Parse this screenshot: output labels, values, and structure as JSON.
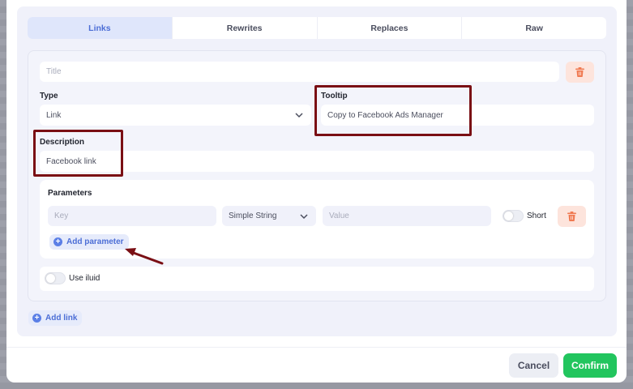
{
  "tabs": [
    {
      "label": "Links",
      "active": true
    },
    {
      "label": "Rewrites",
      "active": false
    },
    {
      "label": "Replaces",
      "active": false
    },
    {
      "label": "Raw",
      "active": false
    }
  ],
  "link": {
    "title_placeholder": "Title",
    "type_label": "Type",
    "type_value": "Link",
    "tooltip_label": "Tooltip",
    "tooltip_value": "Copy to Facebook Ads Manager",
    "description_label": "Description",
    "description_value": "Facebook link"
  },
  "parameters": {
    "heading": "Parameters",
    "key_placeholder": "Key",
    "type_value": "Simple String",
    "value_placeholder": "Value",
    "short_label": "Short",
    "short_enabled": false,
    "add_label": "Add parameter"
  },
  "use_iluid": {
    "label": "Use iluid",
    "enabled": false
  },
  "add_link_label": "Add link",
  "footer": {
    "cancel_label": "Cancel",
    "confirm_label": "Confirm"
  },
  "colors": {
    "accent": "#4c6ed6",
    "confirm": "#22c55e",
    "danger": "#f07a52",
    "highlight": "#7a0f14"
  }
}
